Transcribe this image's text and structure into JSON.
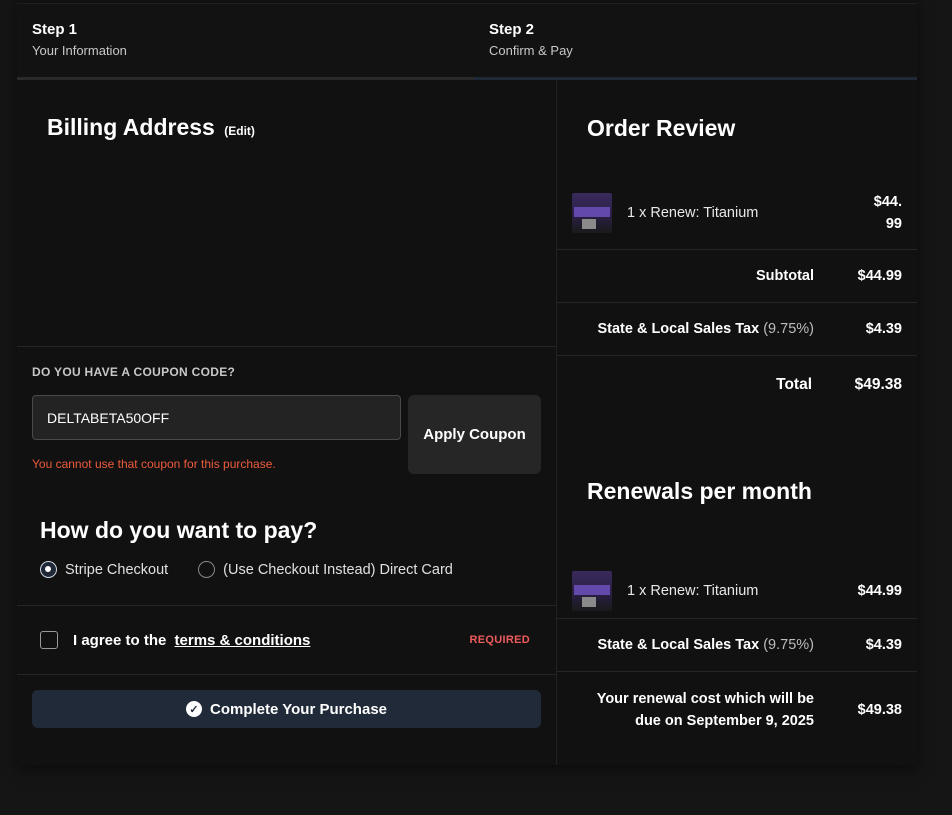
{
  "steps": [
    {
      "title": "Step 1",
      "subtitle": "Your Information"
    },
    {
      "title": "Step 2",
      "subtitle": "Confirm & Pay"
    }
  ],
  "billing": {
    "title": "Billing Address",
    "edit_label": "(Edit)"
  },
  "coupon": {
    "label": "DO YOU HAVE A COUPON CODE?",
    "value": "DELTABETA50OFF",
    "apply_label": "Apply Coupon",
    "error": "You cannot use that coupon for this purchase."
  },
  "payment": {
    "title": "How do you want to pay?",
    "options": [
      "Stripe Checkout",
      "(Use Checkout Instead) Direct Card"
    ],
    "selected": "Stripe Checkout"
  },
  "terms": {
    "prefix": "I agree to the",
    "link": "terms & conditions",
    "required": "REQUIRED"
  },
  "complete_label": "Complete Your Purchase",
  "order_review": {
    "title": "Order Review",
    "item": {
      "name": "1 x Renew: Titanium",
      "price_line1": "$44.",
      "price_line2": "99"
    },
    "subtotal_label": "Subtotal",
    "subtotal": "$44.99",
    "tax_label": "State & Local Sales Tax",
    "tax_pct": "(9.75%)",
    "tax": "$4.39",
    "total_label": "Total",
    "total": "$49.38"
  },
  "renewals": {
    "title": "Renewals per month",
    "item": {
      "name": "1 x Renew: Titanium",
      "price": "$44.99"
    },
    "tax_label": "State & Local Sales Tax",
    "tax_pct": "(9.75%)",
    "tax": "$4.39",
    "renewal_label_1": "Your renewal cost which will be",
    "renewal_label_2": "due on September 9, 2025",
    "renewal_total": "$49.38"
  },
  "colors": {
    "accent": "#202a38",
    "error": "#ef5b3c"
  }
}
